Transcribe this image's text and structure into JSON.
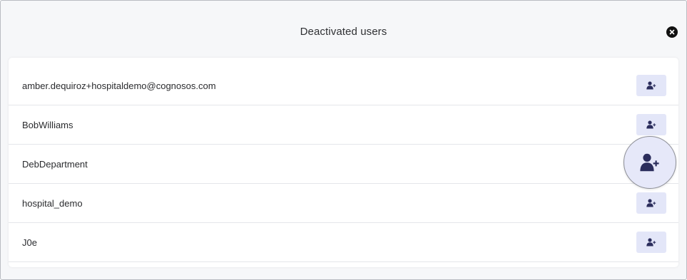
{
  "dialog": {
    "title": "Deactivated users",
    "close_icon": "close-icon"
  },
  "users": [
    {
      "name": "amber.dequiroz+hospitaldemo@cognosos.com",
      "action_icon": "user-plus-icon"
    },
    {
      "name": "BobWilliams",
      "action_icon": "user-plus-icon"
    },
    {
      "name": "DebDepartment",
      "action_icon": "user-plus-icon"
    },
    {
      "name": "hospital_demo",
      "action_icon": "user-plus-icon"
    },
    {
      "name": "J0e",
      "action_icon": "user-plus-icon"
    }
  ],
  "colors": {
    "icon": "#2b2d5c",
    "button_bg": "#e3e6f8",
    "close_bg": "#111111"
  }
}
